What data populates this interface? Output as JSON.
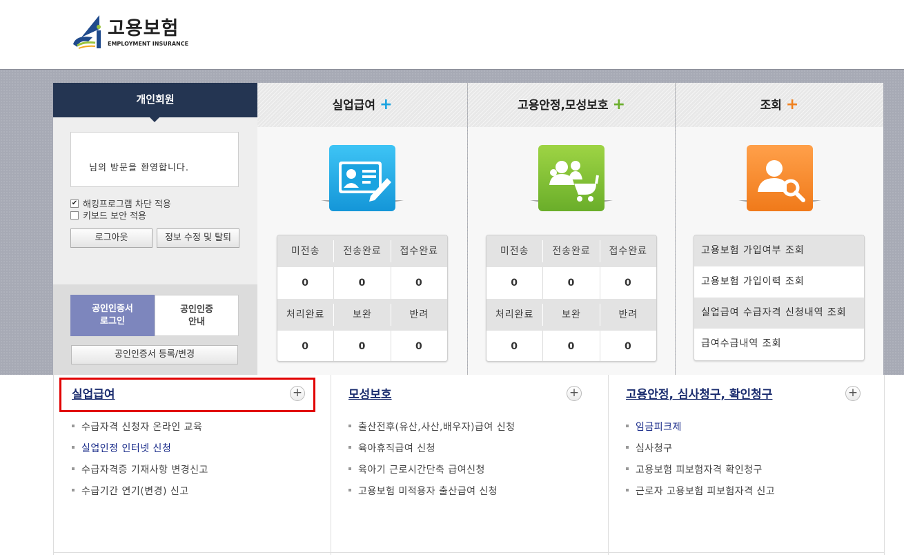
{
  "brand": {
    "name_kr": "고용보험",
    "name_en": "EMPLOYMENT INSURANCE"
  },
  "login": {
    "tab_label": "개인회원",
    "welcome_text": "님의 방문을 환영합니다.",
    "options": [
      {
        "label": "해킹프로그램 차단 적용",
        "checked": true
      },
      {
        "label": "키보드 보안 적용",
        "checked": false
      }
    ],
    "logout_label": "로그아웃",
    "edit_label": "정보 수정 및 탈퇴",
    "cert_login_line1": "공인인증서",
    "cert_login_line2": "로그인",
    "cert_guide_line1": "공인인증",
    "cert_guide_line2": "안내",
    "cert_register_label": "공인인증서 등록/변경"
  },
  "columns": [
    {
      "title": "실업급여",
      "plus": "+",
      "color": "#1aa3e0",
      "status_heads_1": [
        "미전송",
        "전송완료",
        "접수완료"
      ],
      "status_vals_1": [
        "0",
        "0",
        "0"
      ],
      "status_heads_2": [
        "처리완료",
        "보완",
        "반려"
      ],
      "status_vals_2": [
        "0",
        "0",
        "0"
      ]
    },
    {
      "title": "고용안정,모성보호",
      "plus": "+",
      "color": "#6aae2a",
      "status_heads_1": [
        "미전송",
        "전송완료",
        "접수완료"
      ],
      "status_vals_1": [
        "0",
        "0",
        "0"
      ],
      "status_heads_2": [
        "처리완료",
        "보완",
        "반려"
      ],
      "status_vals_2": [
        "0",
        "0",
        "0"
      ]
    },
    {
      "title": "조회",
      "plus": "+",
      "color": "#f0811f",
      "lookups": [
        "고용보험 가입여부 조회",
        "고용보험 가입이력 조회",
        "실업급여 수급자격 신청내역 조회",
        "급여수급내역 조회"
      ]
    }
  ],
  "bottom": [
    {
      "title": "실업급여",
      "items": [
        "수급자격 신청자 온라인 교육",
        "실업인정 인터넷 신청",
        "수급자격증 기재사항 변경신고",
        "수급기간 연기(변경) 신고"
      ],
      "highlight_index": 1
    },
    {
      "title": "모성보호",
      "items": [
        "출산전후(유산,사산,배우자)급여 신청",
        "육아휴직급여 신청",
        "육아기 근로시간단축 급여신청",
        "고용보험 미적용자 출산급여 신청"
      ]
    },
    {
      "title": "고용안정, 심사청구, 확인청구",
      "items": [
        "임금피크제",
        "심사청구",
        "고용보험 피보험자격 확인청구",
        "근로자 고용보험 피보험자격 신고"
      ],
      "highlight_index": 0
    }
  ],
  "plus_symbol": "+"
}
